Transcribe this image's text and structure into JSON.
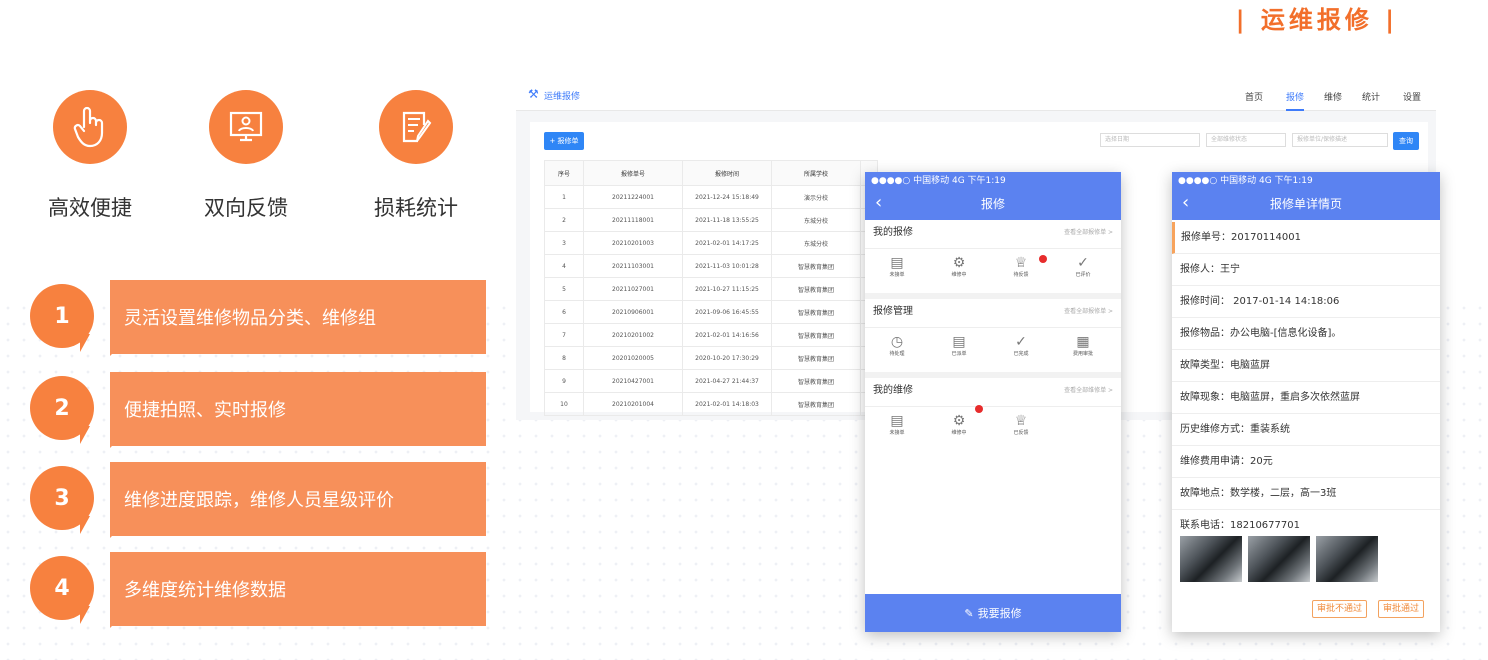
{
  "page_title": "| 运维报修 |",
  "features": [
    "高效便捷",
    "双向反馈",
    "损耗统计"
  ],
  "benefits": [
    {
      "num": "1",
      "text": "灵活设置维修物品分类、维修组"
    },
    {
      "num": "2",
      "text": "便捷拍照、实时报修"
    },
    {
      "num": "3",
      "text": "维修进度跟踪，维修人员星级评价"
    },
    {
      "num": "4",
      "text": "多维度统计维修数据"
    }
  ],
  "desktop": {
    "app_name": "运维报修",
    "nav": [
      "首页",
      "报修",
      "维修",
      "统计",
      "设置"
    ],
    "add_button": "+ 报修单",
    "filters": [
      "选择日期",
      "全部维修状态",
      "报修单位/保修描述"
    ],
    "query_button": "查询",
    "columns": [
      "序号",
      "报修单号",
      "报修时间",
      "所属学校"
    ],
    "rows": [
      [
        "1",
        "20211224001",
        "2021-12-24 15:18:49",
        "演示分校"
      ],
      [
        "2",
        "20211118001",
        "2021-11-18 13:55:25",
        "东城分校"
      ],
      [
        "3",
        "20210201003",
        "2021-02-01 14:17:25",
        "东城分校"
      ],
      [
        "4",
        "20211103001",
        "2021-11-03 10:01:28",
        "智慧教育集团"
      ],
      [
        "5",
        "20211027001",
        "2021-10-27 11:15:25",
        "智慧教育集团"
      ],
      [
        "6",
        "20210906001",
        "2021-09-06 16:45:55",
        "智慧教育集团"
      ],
      [
        "7",
        "20210201002",
        "2021-02-01 14:16:56",
        "智慧教育集团"
      ],
      [
        "8",
        "20201020005",
        "2020-10-20 17:30:29",
        "智慧教育集团"
      ],
      [
        "9",
        "20210427001",
        "2021-04-27 21:44:37",
        "智慧教育集团"
      ],
      [
        "10",
        "20210201004",
        "2021-02-01 14:18:03",
        "智慧教育集团"
      ]
    ]
  },
  "phone1": {
    "status": "●●●●○ 中国移动 4G      下午1:19",
    "title": "报修",
    "sections": [
      {
        "title": "我的报修",
        "more": "查看全部报修单 >",
        "items": [
          "未接单",
          "维修中",
          "待反馈",
          "已评价"
        ]
      },
      {
        "title": "报修管理",
        "more": "查看全部报修单 >",
        "items": [
          "待处理",
          "已派单",
          "已完成",
          "费用审批"
        ]
      },
      {
        "title": "我的维修",
        "more": "查看全部维修单 >",
        "items": [
          "未接单",
          "维修中",
          "已反馈"
        ]
      }
    ],
    "bottom_button": "我要报修"
  },
  "phone2": {
    "status": "●●●●○ 中国移动 4G      下午1:19",
    "title": "报修单详情页",
    "details": [
      "报修单号：20170114001",
      "报修人：王宁",
      "报修时间：  2017-01-14  14:18:06",
      "报修物品：办公电脑-[信息化设备]。",
      "故障类型：电脑蓝屏",
      "故障现象：电脑蓝屏，重启多次依然蓝屏",
      "历史维修方式：重装系统",
      "维修费用申请：20元",
      "故障地点：数学楼，二层，高一3班",
      "联系电话：18210677701"
    ],
    "reject_button": "审批不通过",
    "approve_button": "审批通过"
  },
  "colors": {
    "orange": "#f7813f",
    "blue": "#5b82f0",
    "link_blue": "#2f86f6"
  }
}
